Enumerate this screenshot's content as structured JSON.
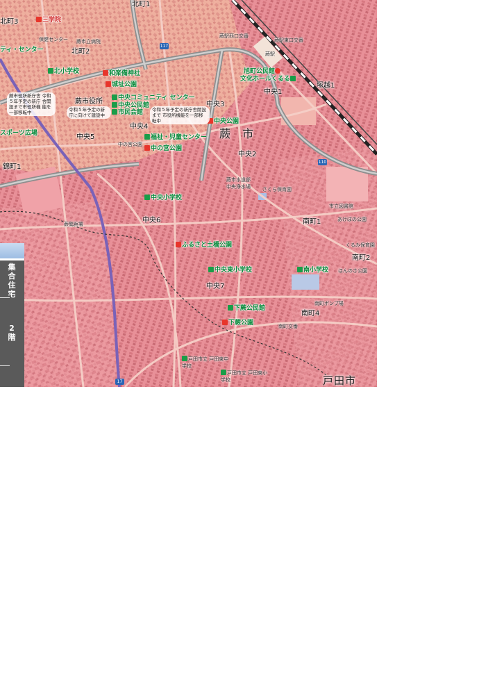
{
  "map": {
    "city_name": "蕨 市",
    "city_name_2": "戸田市",
    "areas": [
      "北町1",
      "北町2",
      "北町3",
      "中央1",
      "中央2",
      "中央3",
      "中央4",
      "中央5",
      "中央6",
      "中央7",
      "南町1",
      "南町2",
      "南町4",
      "錦町1",
      "塚越1"
    ],
    "roads": [
      "117",
      "110",
      "17"
    ],
    "facilities": {
      "f_sangakuin": "三学院",
      "f_kita_es": "北小学校",
      "f_wakamiya": "和楽備神社",
      "f_shiro": "城址公園",
      "f_chuo_cc": "中央コミュニティ センター",
      "f_chuo_kominkan": "中央公民館",
      "f_shimin_kaikan": "市民会館",
      "f_asahi": "旭町公民館",
      "f_bunka": "文化ホールくるる",
      "f_chuo_park": "中央公園",
      "f_fukushi": "福祉・児童センター",
      "f_nakanomiya": "中の宮公園",
      "f_chuo_es": "中央小学校",
      "f_furusato": "ふるさと土橋公園",
      "f_chuo_higashi": "中央東小学校",
      "f_minami_es": "南小学校",
      "f_shimokura_k": "下蕨公民館",
      "f_shimokura_p": "下蕨公園",
      "f_toda_jhs": "戸田市立 戸田東中学校",
      "f_toda_es": "戸田市立 戸田東小学校",
      "f_city_hall": "蕨市役所",
      "f_sports": "スポーツ広場",
      "f_community_center": "ティ・センター"
    },
    "small_labels": {
      "s1": "蕨市立病院",
      "s2": "蕨駅西口交番",
      "s3": "蕨駅東口交番",
      "s4": "蕨駅",
      "s5": "中の宮公園",
      "s6": "蕨市水道部 中央浄水場",
      "s7": "さくら保育園",
      "s8": "市立図書館",
      "s9": "蕨警察署",
      "s10": "あけぼの公園",
      "s11": "くるみ保育園",
      "s12": "ほんのさ公園",
      "s13": "南町ポンプ場",
      "s14": "南町交番",
      "s15": "保健センター",
      "s16": "蕨市立病院"
    },
    "notes": {
      "n1": "蕨市役所新庁舎 令和５年予定の新庁 舎開設まで市役所機 能を一部移転中",
      "n2": "令和５年予定の新 庁に向けて建設中",
      "n3": "令和５年予定の新庁舎開設まで 市役所機能を一部移転中"
    }
  },
  "legend": {
    "title": "集合住宅",
    "floor": "2階"
  },
  "colors": {
    "map_base": "#e9949b",
    "road": "#f2c6c0",
    "major_road": "#8f8f8f",
    "route_purple": "#7a62b8",
    "facility_green": "#0a8a3c",
    "legend_bg": "#5a5a5a"
  }
}
